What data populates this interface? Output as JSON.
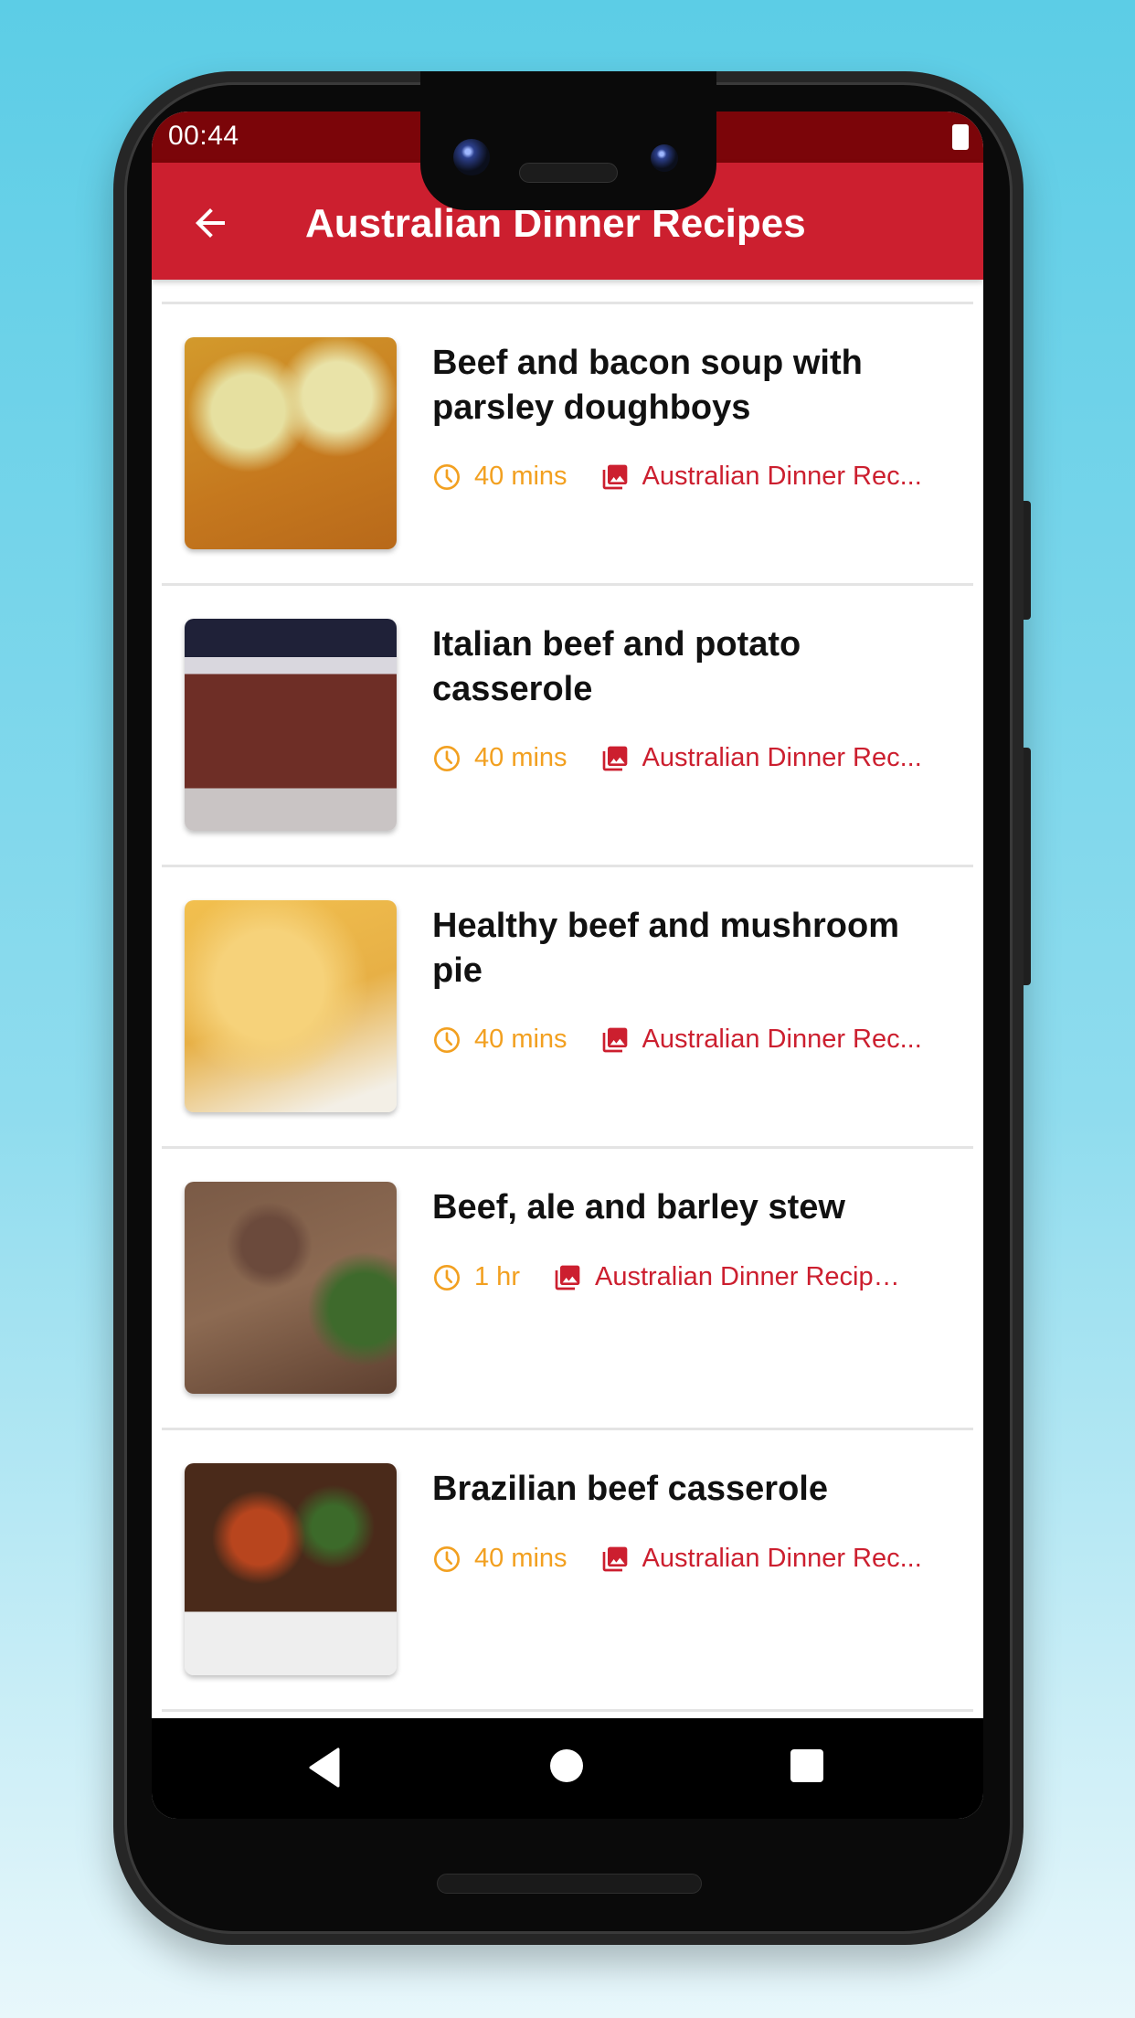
{
  "status_bar": {
    "time": "00:44",
    "battery_icon": "battery-full-icon"
  },
  "app_bar": {
    "title": "Australian Dinner Recipes",
    "back_icon": "arrow-back-icon"
  },
  "colors": {
    "primary": "#cc1f2f",
    "status_bar": "#7b0509",
    "duration": "#f2a020",
    "category": "#cc1f2f"
  },
  "recipes": [
    {
      "title": "Beef and bacon soup with parsley doughboys",
      "duration": "40 mins",
      "category": "Australian Dinner Rec...",
      "image": "soup with dumplings"
    },
    {
      "title": "Italian beef and potato casserole",
      "duration": "40 mins",
      "category": "Australian Dinner Rec...",
      "image": "beef casserole in bowl"
    },
    {
      "title": "Healthy beef and mushroom pie",
      "duration": "40 mins",
      "category": "Australian Dinner Rec...",
      "image": "filo pastry pie"
    },
    {
      "title": "Beef, ale and barley stew",
      "duration": "1 hr",
      "category": "Australian Dinner Recipes",
      "image": "beef barley stew"
    },
    {
      "title": "Brazilian beef casserole",
      "duration": "40 mins",
      "category": "Australian Dinner Rec...",
      "image": "beef casserole over rice"
    }
  ],
  "nav_bar": {
    "back": "nav-back-icon",
    "home": "nav-home-icon",
    "recents": "nav-recents-icon"
  }
}
